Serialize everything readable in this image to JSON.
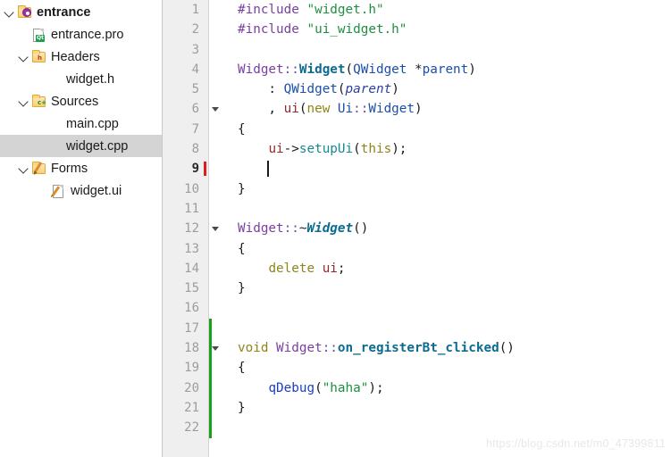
{
  "sidebar": {
    "name": "project-tree",
    "rows": [
      {
        "label": "entrance",
        "indent": 0,
        "twisty": "open",
        "icon": "qt-project-folder-icon",
        "bold": true,
        "selected": false
      },
      {
        "label": "entrance.pro",
        "indent": 2,
        "twisty": "none",
        "icon": "qt-pro-file-icon",
        "bold": false,
        "selected": false
      },
      {
        "label": "Headers",
        "indent": 1,
        "twisty": "open",
        "icon": "headers-folder-icon",
        "bold": false,
        "selected": false
      },
      {
        "label": "widget.h",
        "indent": 3,
        "twisty": "none",
        "icon": "none",
        "bold": false,
        "selected": false
      },
      {
        "label": "Sources",
        "indent": 1,
        "twisty": "open",
        "icon": "sources-folder-icon",
        "bold": false,
        "selected": false
      },
      {
        "label": "main.cpp",
        "indent": 3,
        "twisty": "none",
        "icon": "none",
        "bold": false,
        "selected": false
      },
      {
        "label": "widget.cpp",
        "indent": 3,
        "twisty": "none",
        "icon": "none",
        "bold": false,
        "selected": true
      },
      {
        "label": "Forms",
        "indent": 1,
        "twisty": "open",
        "icon": "forms-folder-icon",
        "bold": false,
        "selected": false
      },
      {
        "label": "widget.ui",
        "indent": 2,
        "twisty": "none",
        "icon": "ui-file-icon",
        "bold": false,
        "selected": false
      }
    ]
  },
  "editor": {
    "name": "code-editor",
    "file": "widget.cpp",
    "current_line": 9,
    "cursor_column": 5,
    "lines": [
      {
        "n": 1,
        "fold": false,
        "changed": false,
        "text": "#include \"widget.h\""
      },
      {
        "n": 2,
        "fold": false,
        "changed": false,
        "text": "#include \"ui_widget.h\""
      },
      {
        "n": 3,
        "fold": false,
        "changed": false,
        "text": ""
      },
      {
        "n": 4,
        "fold": false,
        "changed": false,
        "text": "Widget::Widget(QWidget *parent)"
      },
      {
        "n": 5,
        "fold": false,
        "changed": false,
        "text": "    : QWidget(parent)"
      },
      {
        "n": 6,
        "fold": true,
        "changed": false,
        "text": "    , ui(new Ui::Widget)"
      },
      {
        "n": 7,
        "fold": false,
        "changed": false,
        "text": "{"
      },
      {
        "n": 8,
        "fold": false,
        "changed": false,
        "text": "    ui->setupUi(this);"
      },
      {
        "n": 9,
        "fold": false,
        "changed": false,
        "text": "    "
      },
      {
        "n": 10,
        "fold": false,
        "changed": false,
        "text": "}"
      },
      {
        "n": 11,
        "fold": false,
        "changed": false,
        "text": ""
      },
      {
        "n": 12,
        "fold": true,
        "changed": false,
        "text": "Widget::~Widget()"
      },
      {
        "n": 13,
        "fold": false,
        "changed": false,
        "text": "{"
      },
      {
        "n": 14,
        "fold": false,
        "changed": false,
        "text": "    delete ui;"
      },
      {
        "n": 15,
        "fold": false,
        "changed": false,
        "text": "}"
      },
      {
        "n": 16,
        "fold": false,
        "changed": false,
        "text": ""
      },
      {
        "n": 17,
        "fold": false,
        "changed": true,
        "text": ""
      },
      {
        "n": 18,
        "fold": true,
        "changed": true,
        "text": "void Widget::on_registerBt_clicked()"
      },
      {
        "n": 19,
        "fold": false,
        "changed": true,
        "text": "{"
      },
      {
        "n": 20,
        "fold": false,
        "changed": true,
        "text": "    qDebug(\"haha\");"
      },
      {
        "n": 21,
        "fold": false,
        "changed": true,
        "text": "}"
      },
      {
        "n": 22,
        "fold": false,
        "changed": true,
        "text": ""
      }
    ]
  },
  "watermark": {
    "text": "https://blog.csdn.net/m0_47399811"
  },
  "colors": {
    "selection": "#d4d4d4",
    "gutter_bg": "#efefef",
    "change_bar": "#17a01c",
    "caret_mark": "#e01b1b",
    "string": "#1d8f3f",
    "preprocessor": "#7a3ea1",
    "function": "#0c6b8f",
    "keyword": "#8f8419",
    "member": "#8e2a2a",
    "type": "#1b4fa8"
  }
}
